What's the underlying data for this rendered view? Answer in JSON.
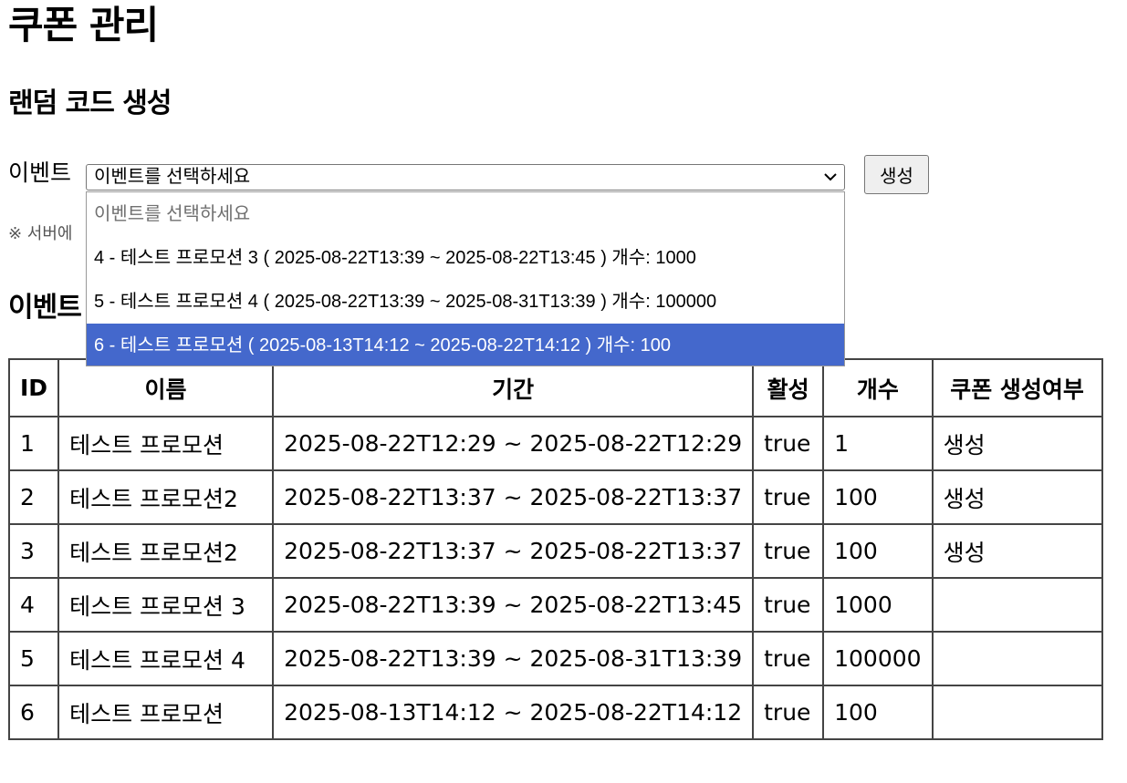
{
  "page": {
    "title": "쿠폰 관리"
  },
  "random_code": {
    "section_title": "랜덤 코드 생성",
    "event_label": "이벤트",
    "select_value": "이벤트를 선택하세요",
    "generate_button": "생성",
    "note": "※ 서버에",
    "options": [
      {
        "label": "이벤트를 선택하세요",
        "placeholder": true,
        "selected": false
      },
      {
        "label": "4 - 테스트 프로모션 3 ( 2025-08-22T13:39 ~ 2025-08-22T13:45 ) 개수: 1000",
        "placeholder": false,
        "selected": false
      },
      {
        "label": "5 - 테스트 프로모션 4 ( 2025-08-22T13:39 ~ 2025-08-31T13:39 ) 개수: 100000",
        "placeholder": false,
        "selected": false
      },
      {
        "label": "6 - 테스트 프로모션 ( 2025-08-13T14:12 ~ 2025-08-22T14:12 ) 개수: 100",
        "placeholder": false,
        "selected": true
      }
    ]
  },
  "event_list": {
    "heading": "이벤트",
    "columns": [
      "ID",
      "이름",
      "기간",
      "활성",
      "개수",
      "쿠폰 생성여부"
    ],
    "rows": [
      [
        "1",
        "테스트 프로모션",
        "2025-08-22T12:29 ~ 2025-08-22T12:29",
        "true",
        "1",
        "생성"
      ],
      [
        "2",
        "테스트 프로모션2",
        "2025-08-22T13:37 ~ 2025-08-22T13:37",
        "true",
        "100",
        "생성"
      ],
      [
        "3",
        "테스트 프로모션2",
        "2025-08-22T13:37 ~ 2025-08-22T13:37",
        "true",
        "100",
        "생성"
      ],
      [
        "4",
        "테스트 프로모션 3",
        "2025-08-22T13:39 ~ 2025-08-22T13:45",
        "true",
        "1000",
        ""
      ],
      [
        "5",
        "테스트 프로모션 4",
        "2025-08-22T13:39 ~ 2025-08-31T13:39",
        "true",
        "100000",
        ""
      ],
      [
        "6",
        "테스트 프로모션",
        "2025-08-13T14:12 ~ 2025-08-22T14:12",
        "true",
        "100",
        ""
      ]
    ]
  },
  "colors": {
    "selected_option": "#4468cc",
    "border": "#444444"
  }
}
